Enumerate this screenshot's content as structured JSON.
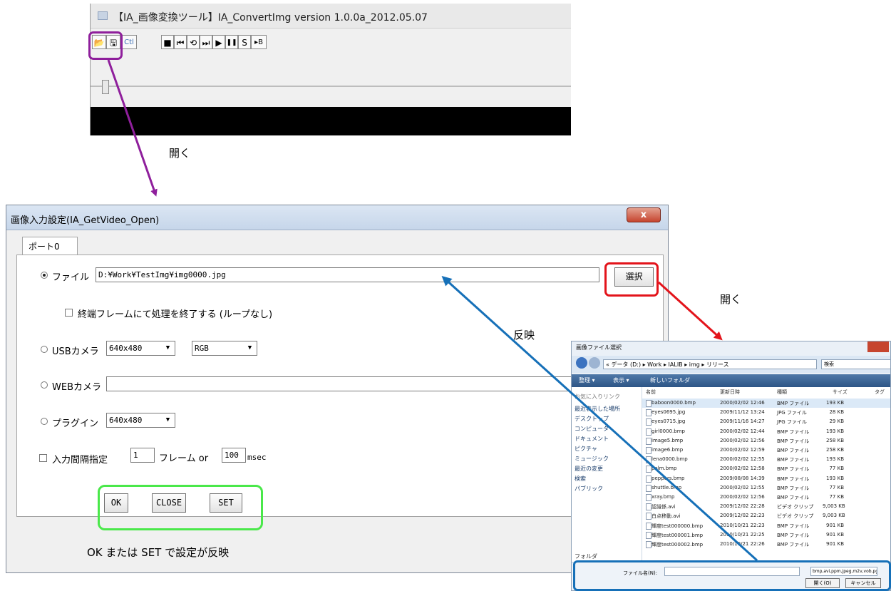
{
  "top_window": {
    "title": "【IA_画像変換ツール】IA_ConvertImg version 1.0.0a_2012.05.07",
    "toolbar": [
      {
        "name": "open-folder-icon",
        "glyph": "📂"
      },
      {
        "name": "save-icon",
        "glyph": "🖫"
      },
      {
        "name": "ctl-button",
        "glyph": "Ctl"
      },
      {
        "name": "stop-icon",
        "glyph": "■"
      },
      {
        "name": "skip-back-icon",
        "glyph": "⏮"
      },
      {
        "name": "loop-icon",
        "glyph": "⟲"
      },
      {
        "name": "step-forward-icon",
        "glyph": "⏭"
      },
      {
        "name": "play-icon",
        "glyph": "▶"
      },
      {
        "name": "pause-icon",
        "glyph": "❚❚"
      },
      {
        "name": "s-button",
        "glyph": "S"
      },
      {
        "name": "play-b-icon",
        "glyph": "▸B"
      }
    ]
  },
  "annotations": {
    "open_top": "開く",
    "open_right": "開く",
    "reflect": "反映",
    "note_bottom": "OK または SET で設定が反映"
  },
  "dialog": {
    "title": "画像入力設定(IA_GetVideo_Open)",
    "close_glyph": "x",
    "tab": "ポート0",
    "file_label": "ファイル",
    "file_path": "D:¥Work¥TestImg¥img0000.jpg",
    "select_button": "選択",
    "end_frame_label": "終端フレームにて処理を終了する (ループなし)",
    "usb_label": "USBカメラ",
    "usb_resolution": "640x480",
    "usb_color": "RGB",
    "web_label": "WEBカメラ",
    "web_value": "",
    "plugin_label": "プラグイン",
    "plugin_resolution": "640x480",
    "interval_label": "入力間隔指定",
    "interval_frames": "1",
    "frames_or_label": "フレーム or",
    "interval_msec": "100",
    "msec_label": "msec",
    "buttons": {
      "ok": "OK",
      "close": "CLOSE",
      "set": "SET"
    }
  },
  "file_dialog": {
    "title": "画像ファイル選択",
    "address": "« データ (D:) ▸ Work ▸ IALIB ▸ img ▸ リリース",
    "search_placeholder": "検索",
    "commands": [
      "整理 ▾",
      "表示 ▾",
      "新しいフォルダ"
    ],
    "nav": [
      "お気に入りリンク",
      "最近表示した場所",
      "デスクトップ",
      "コンピュータ",
      "ドキュメント",
      "ピクチャ",
      "ミュージック",
      "最近の変更",
      "検索",
      "パブリック"
    ],
    "nav_footer": "フォルダ",
    "columns": [
      "名前",
      "更新日時",
      "種類",
      "サイズ",
      "タグ"
    ],
    "files": [
      {
        "name": "baboon0000.bmp",
        "date": "2000/02/02 12:46",
        "type": "BMP ファイル",
        "size": "193 KB"
      },
      {
        "name": "eyes0695.jpg",
        "date": "2009/11/12 13:24",
        "type": "JPG ファイル",
        "size": "28 KB"
      },
      {
        "name": "eyes0715.jpg",
        "date": "2009/11/16 14:27",
        "type": "JPG ファイル",
        "size": "29 KB"
      },
      {
        "name": "girl0000.bmp",
        "date": "2000/02/02 12:44",
        "type": "BMP ファイル",
        "size": "193 KB"
      },
      {
        "name": "image5.bmp",
        "date": "2000/02/02 12:56",
        "type": "BMP ファイル",
        "size": "258 KB"
      },
      {
        "name": "image6.bmp",
        "date": "2000/02/02 12:59",
        "type": "BMP ファイル",
        "size": "258 KB"
      },
      {
        "name": "lena0000.bmp",
        "date": "2000/02/02 12:55",
        "type": "BMP ファイル",
        "size": "193 KB"
      },
      {
        "name": "palm.bmp",
        "date": "2000/02/02 12:58",
        "type": "BMP ファイル",
        "size": "77 KB"
      },
      {
        "name": "peppers.bmp",
        "date": "2009/08/08 14:39",
        "type": "BMP ファイル",
        "size": "193 KB"
      },
      {
        "name": "shuttle.bmp",
        "date": "2000/02/02 12:55",
        "type": "BMP ファイル",
        "size": "77 KB"
      },
      {
        "name": "xray.bmp",
        "date": "2000/02/02 12:56",
        "type": "BMP ファイル",
        "size": "77 KB"
      },
      {
        "name": "認識係.avi",
        "date": "2009/12/02 22:28",
        "type": "ビデオ クリップ",
        "size": "9,003 KB"
      },
      {
        "name": "白点移動.avi",
        "date": "2009/12/02 22:23",
        "type": "ビデオ クリップ",
        "size": "9,003 KB"
      },
      {
        "name": "輝度test000000.bmp",
        "date": "2010/10/21 22:23",
        "type": "BMP ファイル",
        "size": "901 KB"
      },
      {
        "name": "輝度test000001.bmp",
        "date": "2010/10/21 22:25",
        "type": "BMP ファイル",
        "size": "901 KB"
      },
      {
        "name": "輝度test000002.bmp",
        "date": "2010/10/21 22:26",
        "type": "BMP ファイル",
        "size": "901 KB"
      }
    ],
    "filename_label": "ファイル名(N):",
    "filename_value": "",
    "filetype": "bmp,avi,ppm,jpeg,m2v,vob,pgm,p",
    "open_button": "開く(O)",
    "cancel_button": "キャンセル"
  },
  "colors": {
    "purple": "#8f1f9c",
    "red": "#e3141b",
    "blue": "#1670b8",
    "green": "#4ae84a"
  }
}
